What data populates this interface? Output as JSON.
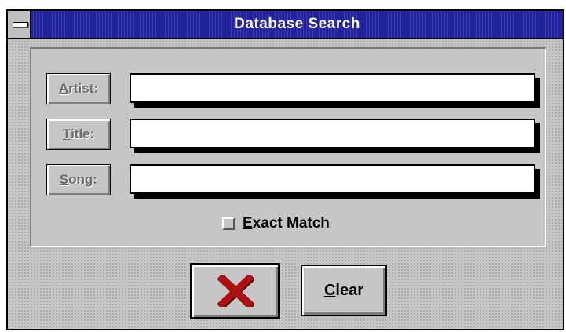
{
  "window": {
    "title": "Database Search"
  },
  "fields": [
    {
      "label_first": "A",
      "label_rest": "rtist:",
      "value": ""
    },
    {
      "label_first": "T",
      "label_rest": "itle:",
      "value": ""
    },
    {
      "label_first": "S",
      "label_rest": "ong:",
      "value": ""
    }
  ],
  "exact_match": {
    "label_first": "E",
    "label_rest": "xact Match",
    "checked": false
  },
  "buttons": {
    "cancel_icon": "red-x-icon",
    "clear_first": "C",
    "clear_rest": "lear"
  },
  "colors": {
    "titlebar": "#2121a2",
    "cancel_x": "#b01010",
    "face": "#c6c6c6"
  }
}
